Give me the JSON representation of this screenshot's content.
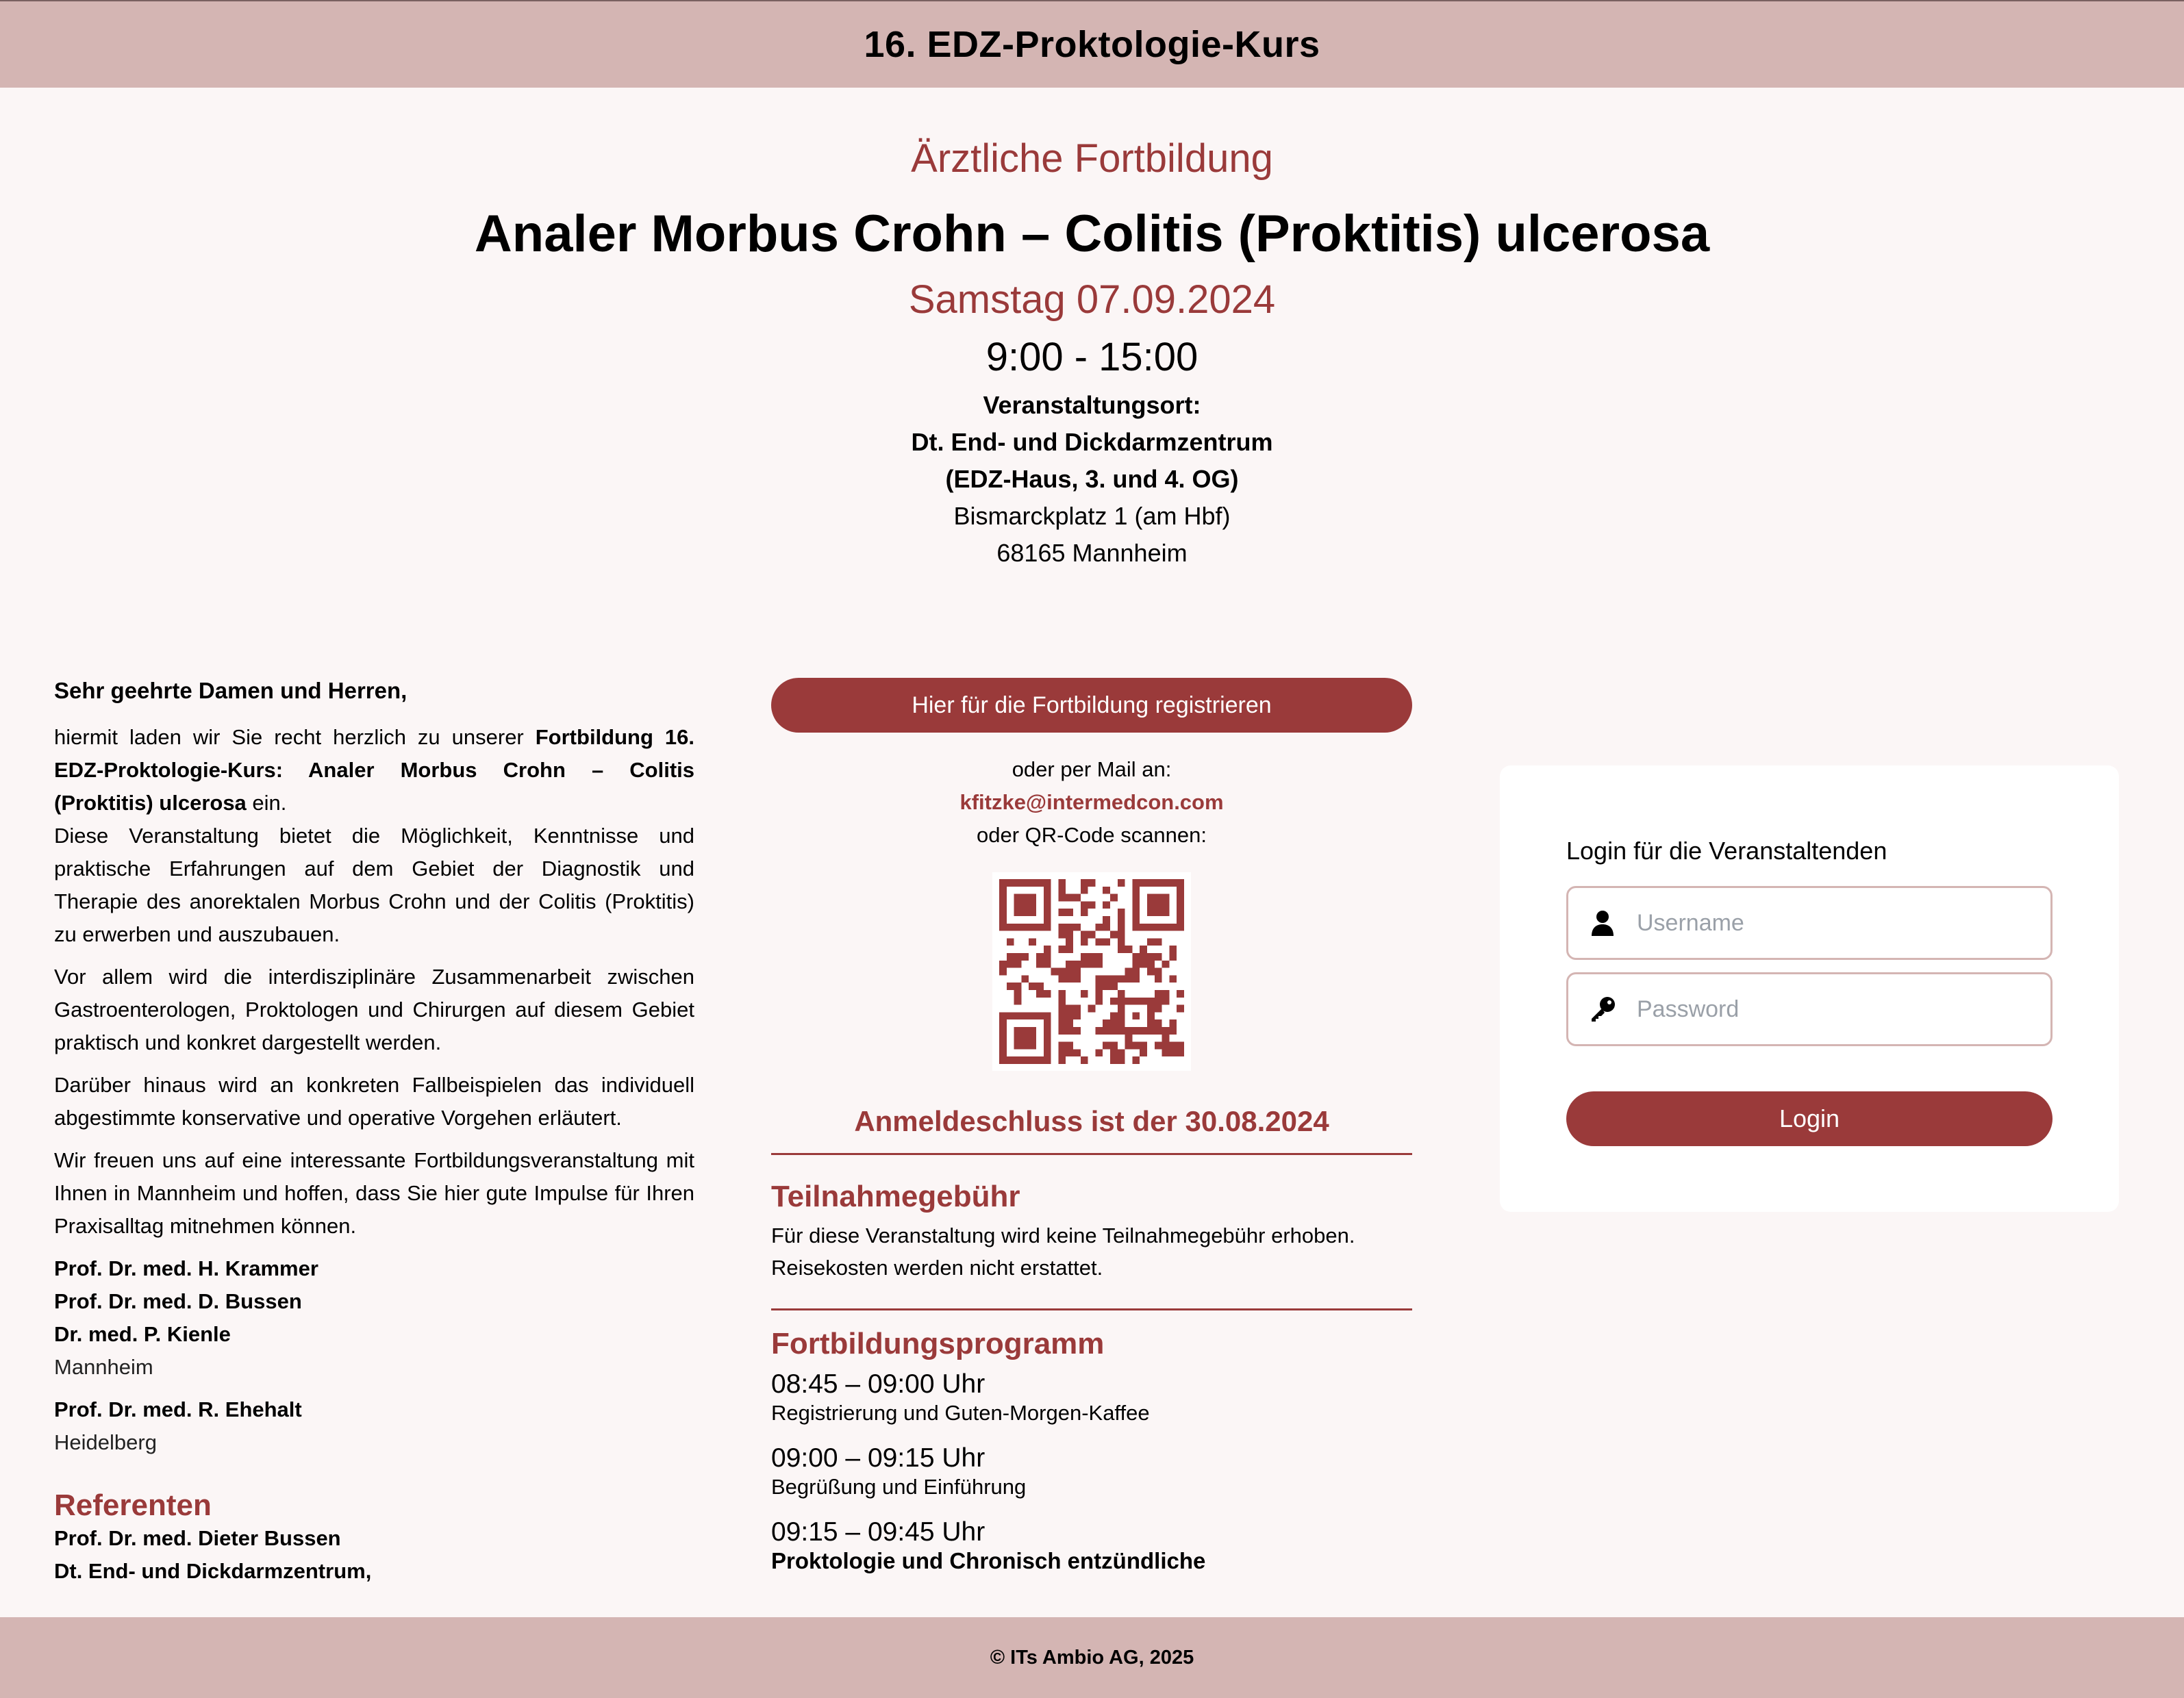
{
  "header": {
    "title": "16. EDZ-Proktologie-Kurs"
  },
  "hero": {
    "kicker": "Ärztliche Fortbildung",
    "title": "Analer Morbus Crohn – Colitis (Proktitis) ulcerosa",
    "date": "Samstag 07.09.2024",
    "time": "9:00 - 15:00",
    "venue_label": "Veranstaltungsort:",
    "venue_name": "Dt. End- und Dickdarmzentrum",
    "venue_building": "(EDZ-Haus, 3. und 4. OG)",
    "venue_street": "Bismarckplatz 1 (am Hbf)",
    "venue_city": "68165 Mannheim"
  },
  "letter": {
    "greeting": "Sehr geehrte Damen und Herren,",
    "p1_pre": "hiermit laden wir Sie recht herzlich zu unserer ",
    "p1_bold": "Fortbildung 16. EDZ-Proktologie-Kurs: Analer Morbus Crohn – Colitis (Proktitis) ulcerosa",
    "p1_post": " ein.",
    "p2": "Diese Veranstaltung bietet die Möglichkeit, Kenntnisse und praktische Erfahrungen auf dem Gebiet der Diagnostik und Therapie des anorektalen Morbus Crohn und der Colitis (Proktitis) zu erwerben und auszubauen.",
    "p3": "Vor allem wird die interdisziplinäre Zusammenarbeit zwischen Gastroenterologen, Proktologen und Chirurgen auf diesem Gebiet praktisch und konkret dargestellt werden.",
    "p4": "Darüber hinaus wird an konkreten Fallbeispielen das individuell abgestimmte konservative und operative Vorgehen erläutert.",
    "p5": "Wir freuen uns auf eine interessante Fortbildungsveranstaltung mit Ihnen in Mannheim und hoffen, dass Sie hier gute Impulse für Ihren Praxisalltag mitnehmen können.",
    "signers_1": [
      "Prof. Dr. med. H. Krammer",
      "Prof. Dr. med. D. Bussen",
      "Dr. med. P. Kienle"
    ],
    "city_1": "Mannheim",
    "signer_2": "Prof. Dr. med. R. Ehehalt",
    "city_2": "Heidelberg",
    "referenten_title": "Referenten",
    "referent_1": "Prof. Dr. med. Dieter Bussen",
    "referent_1_org": "Dt. End- und Dickdarmzentrum,"
  },
  "registration": {
    "button_label": "Hier für die Fortbildung registrieren",
    "mail_prefix": "oder per Mail an:",
    "mail": "kfitzke@intermedcon.com",
    "qr_prefix": "oder QR-Code scannen:",
    "deadline": "Anmeldeschluss ist der 30.08.2024",
    "qr_color": "#9a3a3a"
  },
  "fee": {
    "title": "Teilnahmegebühr",
    "line1": "Für diese Veranstaltung wird keine Teilnahmegebühr erhoben.",
    "line2": "Reisekosten werden nicht erstattet."
  },
  "program": {
    "title": "Fortbildungsprogramm",
    "slots": [
      {
        "time": "08:45 – 09:00 Uhr",
        "desc": "Registrierung und Guten-Morgen-Kaffee"
      },
      {
        "time": "09:00 – 09:15 Uhr",
        "desc": "Begrüßung und Einführung"
      },
      {
        "time": "09:15 – 09:45 Uhr",
        "desc": "Proktologie und Chronisch entzündliche"
      }
    ]
  },
  "login": {
    "title": "Login für die Veranstaltenden",
    "username_placeholder": "Username",
    "password_placeholder": "Password",
    "button_label": "Login"
  },
  "footer": {
    "copyright": "© ITs Ambio AG, 2025"
  },
  "colors": {
    "accent": "#9a3a3a",
    "bar": "#d4b5b3",
    "background": "#fbf6f6"
  }
}
